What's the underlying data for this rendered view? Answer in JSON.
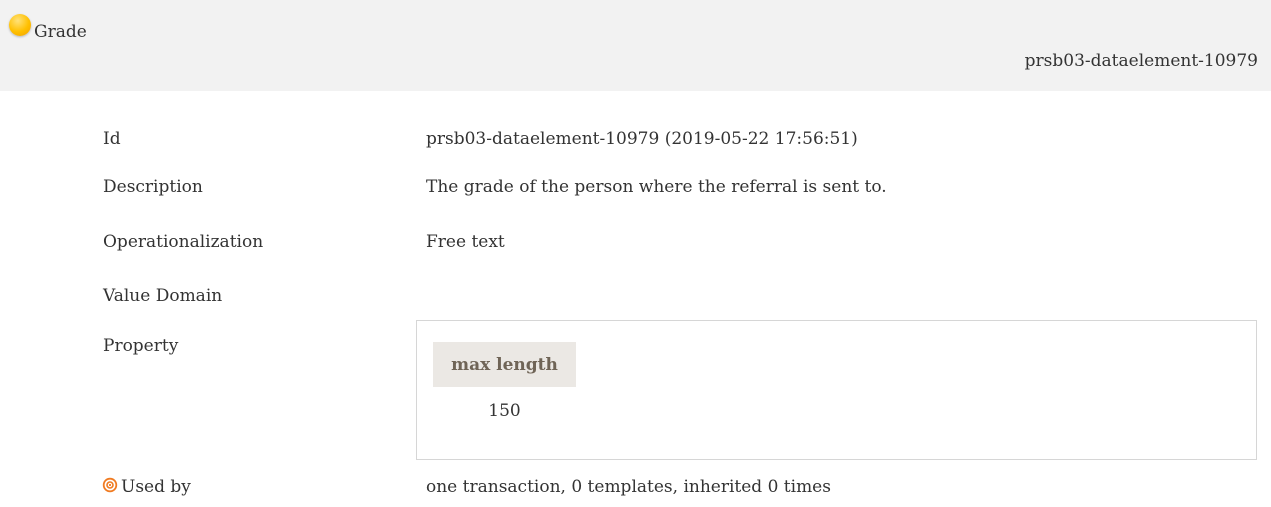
{
  "header": {
    "title": "Grade",
    "id_tag": "prsb03-dataelement-10979"
  },
  "fields": {
    "id": {
      "label": "Id",
      "value": "prsb03-dataelement-10979 (2019-05-22 17:56:51)"
    },
    "description": {
      "label": "Description",
      "value": "The grade of the person where the referral is sent to."
    },
    "operationalization": {
      "label": "Operationalization",
      "value": "Free text"
    },
    "value_domain": {
      "label": "Value Domain"
    },
    "property": {
      "label": "Property",
      "column_header": "max length",
      "column_value": "150"
    },
    "used_by": {
      "label": "Used by",
      "value": "one transaction, 0 templates, inherited 0 times"
    }
  },
  "icons": {
    "header_icon": "status-orb-icon",
    "used_by_icon": "target-icon"
  },
  "colors": {
    "header_bg": "#f2f2f2",
    "orb": "#ffc000",
    "property_header_bg": "#ebe8e4",
    "property_header_text": "#6f6456",
    "target_icon": "#f07b22"
  }
}
